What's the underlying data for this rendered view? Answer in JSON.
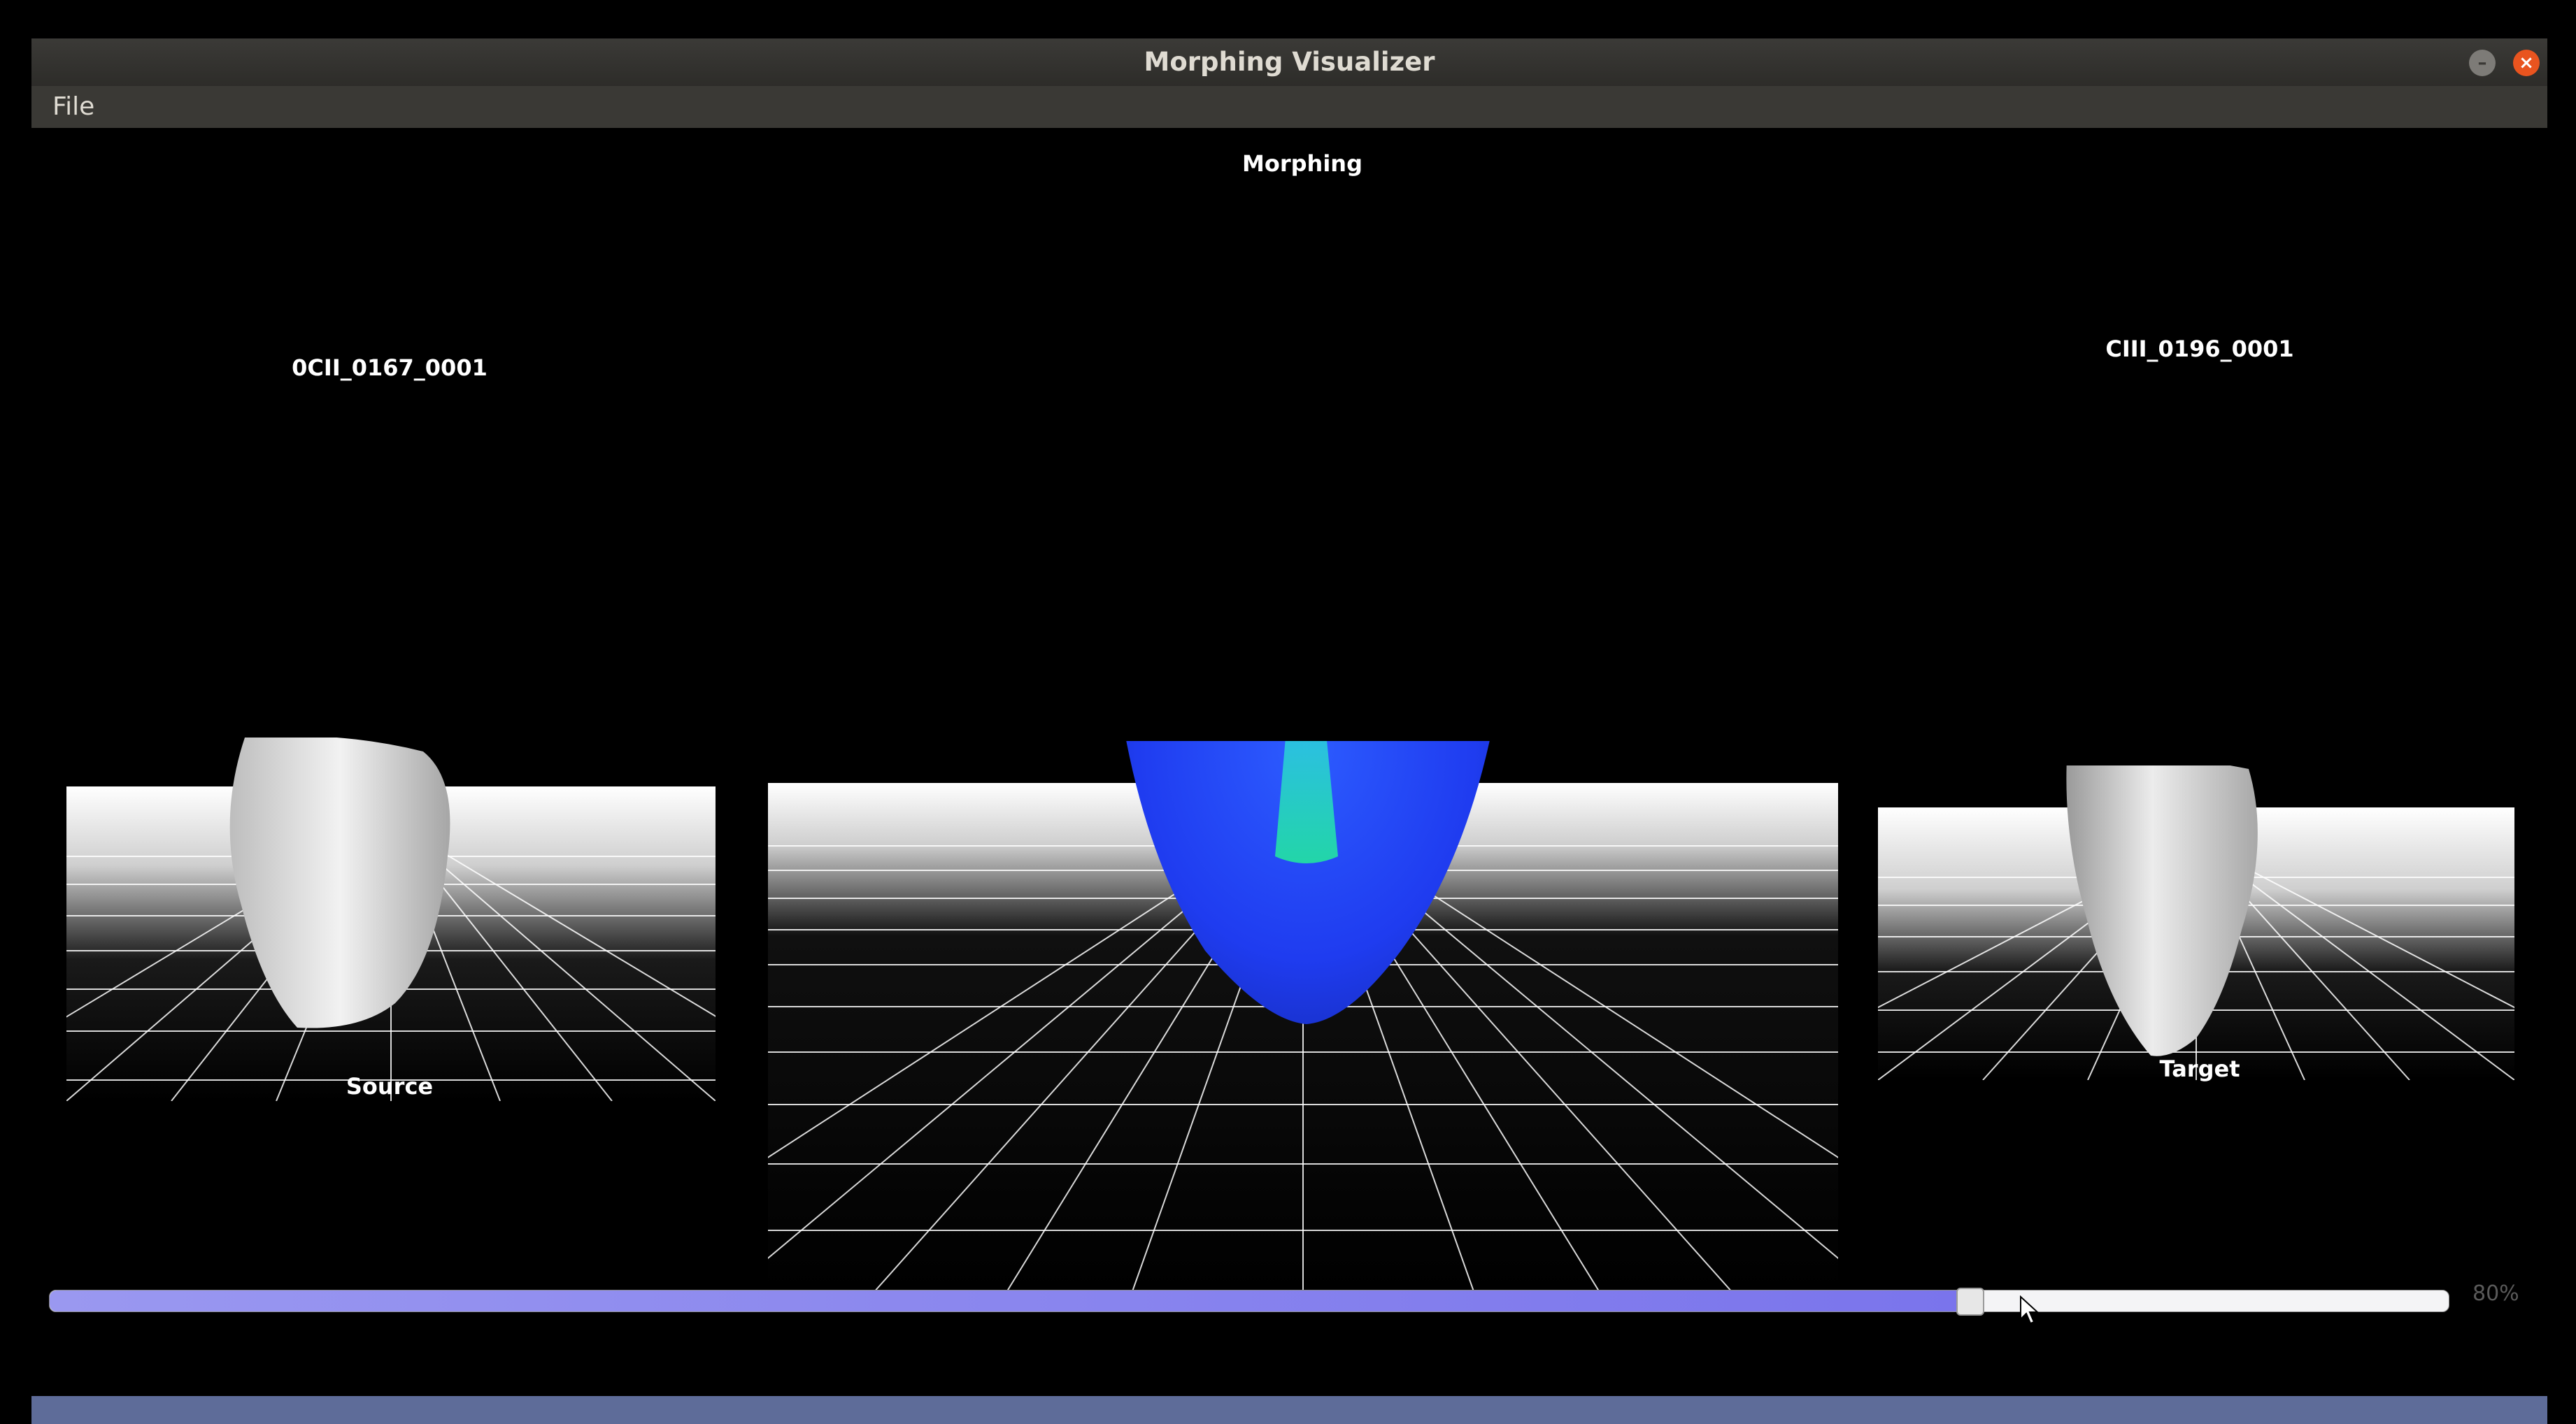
{
  "window": {
    "title": "Morphing Visualizer",
    "minimize_icon": "minimize-icon",
    "close_icon": "close-icon"
  },
  "menu": {
    "file": "File"
  },
  "views": {
    "morph_title": "Morphing",
    "source_name": "0CII_0167_0001",
    "source_caption": "Source",
    "target_name": "CIII_0196_0001",
    "target_caption": "Target"
  },
  "slider": {
    "value_label": "80%",
    "value": 0.8
  },
  "colors": {
    "morph_mesh": "#1f3cf0",
    "mesh_highlight": "#22ee9a",
    "source_mesh": "#d9d9d9",
    "slider_fill": "#7a74ec",
    "close_button": "#e9541f"
  }
}
